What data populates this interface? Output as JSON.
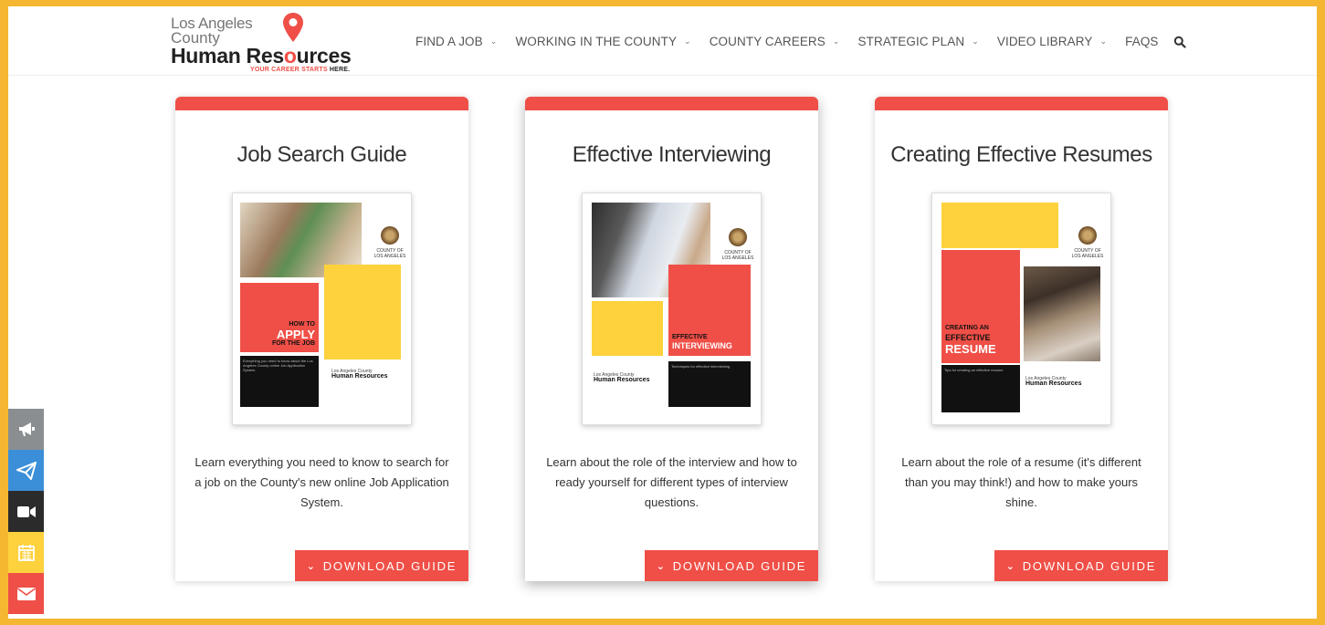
{
  "logo": {
    "line1": "Los Angeles",
    "line2": "County",
    "line3a": "Human Res",
    "line3b": "o",
    "line3c": "urces",
    "tagline_a": "YOUR CAREER STARTS ",
    "tagline_b": "HERE."
  },
  "nav": {
    "items": [
      {
        "label": "FIND A JOB"
      },
      {
        "label": "WORKING IN THE COUNTY"
      },
      {
        "label": "COUNTY CAREERS"
      },
      {
        "label": "STRATEGIC PLAN"
      },
      {
        "label": "VIDEO LIBRARY"
      },
      {
        "label": "FAQS"
      }
    ],
    "search_icon": "search-icon"
  },
  "cards": [
    {
      "title": "Job Search Guide",
      "cover_heading_1": "HOW TO",
      "cover_heading_2": "APPLY",
      "cover_heading_3": "FOR THE JOB",
      "cover_county": "COUNTY OF LOS ANGELES",
      "cover_logo": "Los Angeles County",
      "cover_logo_b": "Human Resources",
      "cover_blurb": "Everything you need to know about the Los Angeles County online Job Application System.",
      "description": "Learn everything you need to know to search for a job on the County's new online Job Application System.",
      "button": "DOWNLOAD GUIDE"
    },
    {
      "title": "Effective Interviewing",
      "cover_heading_1": "EFFECTIVE",
      "cover_heading_2": "INTERVIEWING",
      "cover_county": "COUNTY OF LOS ANGELES",
      "cover_logo": "Los Angeles County",
      "cover_logo_b": "Human Resources",
      "cover_blurb": "Techniques for effective interviewing",
      "description": "Learn about the role of the interview and how to ready yourself for different types of interview questions.",
      "button": "DOWNLOAD GUIDE"
    },
    {
      "title": "Creating Effective Resumes",
      "cover_heading_1": "CREATING AN",
      "cover_heading_2": "EFFECTIVE",
      "cover_heading_3": "RESUME",
      "cover_county": "COUNTY OF LOS ANGELES",
      "cover_logo": "Los Angeles County",
      "cover_logo_b": "Human Resources",
      "cover_blurb": "Tips for creating an effective resume",
      "description": "Learn about the role of a resume (it's different than you may think!) and how to make yours shine.",
      "button": "DOWNLOAD GUIDE"
    }
  ],
  "sidebar": [
    {
      "icon": "megaphone-icon",
      "color": "#8a8e91"
    },
    {
      "icon": "paper-plane-icon",
      "color": "#3b8fd8"
    },
    {
      "icon": "video-camera-icon",
      "color": "#2b2b2b"
    },
    {
      "icon": "calendar-icon",
      "color": "#fdd23c"
    },
    {
      "icon": "envelope-icon",
      "color": "#ef4f47"
    }
  ],
  "colors": {
    "frame": "#f5b731",
    "accent_red": "#ef4f47",
    "accent_yellow": "#fdd23c"
  }
}
